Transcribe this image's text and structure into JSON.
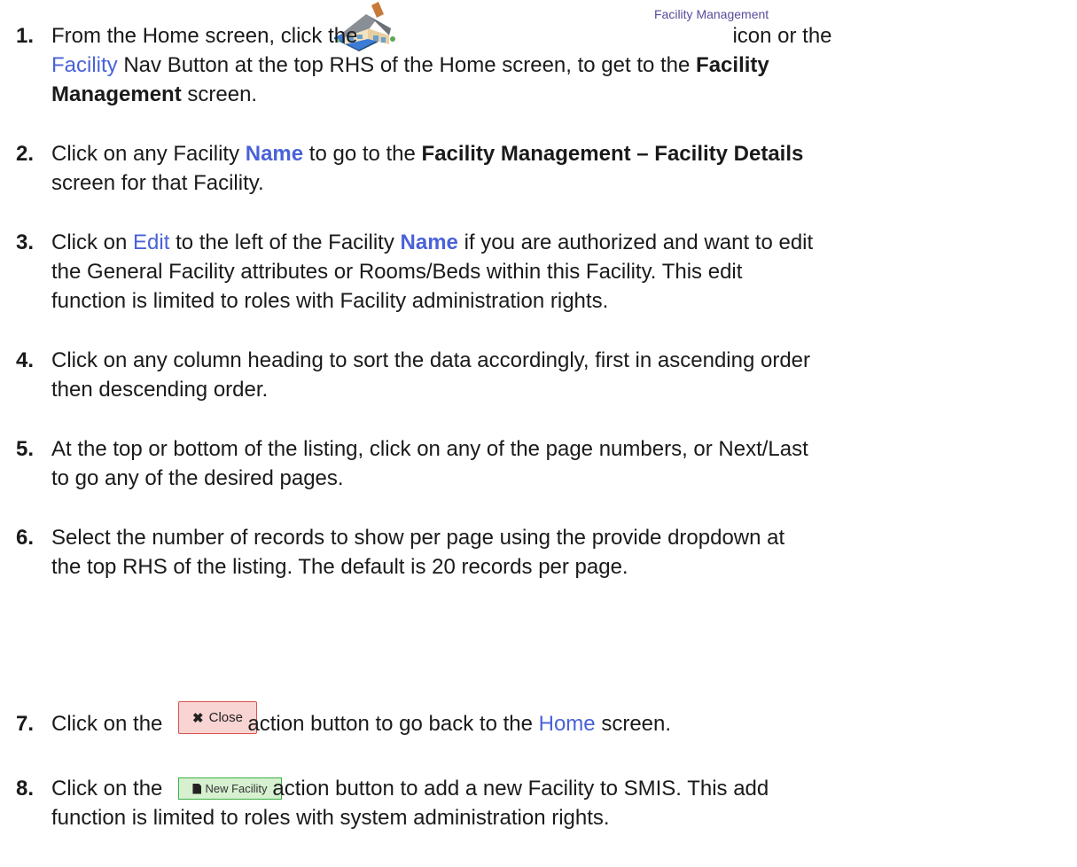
{
  "steps": [
    {
      "number": "1.",
      "seg_a": "From the Home screen, click the",
      "seg_b": "icon or the",
      "link_facility": "Facility",
      "seg_c": "Nav Button at the top RHS of the Home screen, to get to the",
      "bold_fm_1": "Facility",
      "bold_fm_2": "Management",
      "seg_d": "screen."
    },
    {
      "number": "2.",
      "seg_a": "Click on any Facility",
      "link_name": "Name",
      "seg_b": "to go to the",
      "bold_fd": "Facility Management – Facility Details",
      "seg_c": "screen for that Facility."
    },
    {
      "number": "3.",
      "seg_a": "Click on",
      "link_edit": "Edit",
      "seg_b": "to the left of the Facility",
      "link_name": "Name",
      "seg_c": "if you are authorized and want to edit",
      "line2": "the General Facility attributes or Rooms/Beds within this Facility.  This edit",
      "line3": "function is limited to roles with Facility administration rights."
    },
    {
      "number": "4.",
      "line1": "Click on any column heading to sort the data accordingly, first in ascending order",
      "line2": "then descending order."
    },
    {
      "number": "5.",
      "line1": "At the top or bottom of the listing, click on any of the page numbers, or Next/Last",
      "line2": "to go any of the desired pages."
    },
    {
      "number": "6.",
      "line1": "Select the number of records to show per page using the provide dropdown at",
      "line2": "the top RHS of the listing.  The default is 20 records per page."
    },
    {
      "number": "7.",
      "seg_a": "Click on the",
      "seg_b": "action button to go back to the",
      "link_home": "Home",
      "seg_c": "screen."
    },
    {
      "number": "8.",
      "seg_a": "Click on the",
      "seg_b": "action button to add a new Facility to SMIS.  This add",
      "line2": "function is limited to roles with system administration rights."
    }
  ],
  "facility_management_caption": "Facility Management",
  "close_button": {
    "label": "Close",
    "icon_glyph": "✖"
  },
  "new_facility_button": {
    "label": "New Facility"
  },
  "colors": {
    "link": "#4a62d8",
    "close_bg": "#f8d4d2",
    "close_border": "#d9534f",
    "new_bg": "#d6f0d0",
    "new_border": "#3cb043"
  },
  "icons": [
    "facility-house-icon",
    "close-x-icon",
    "document-icon"
  ]
}
